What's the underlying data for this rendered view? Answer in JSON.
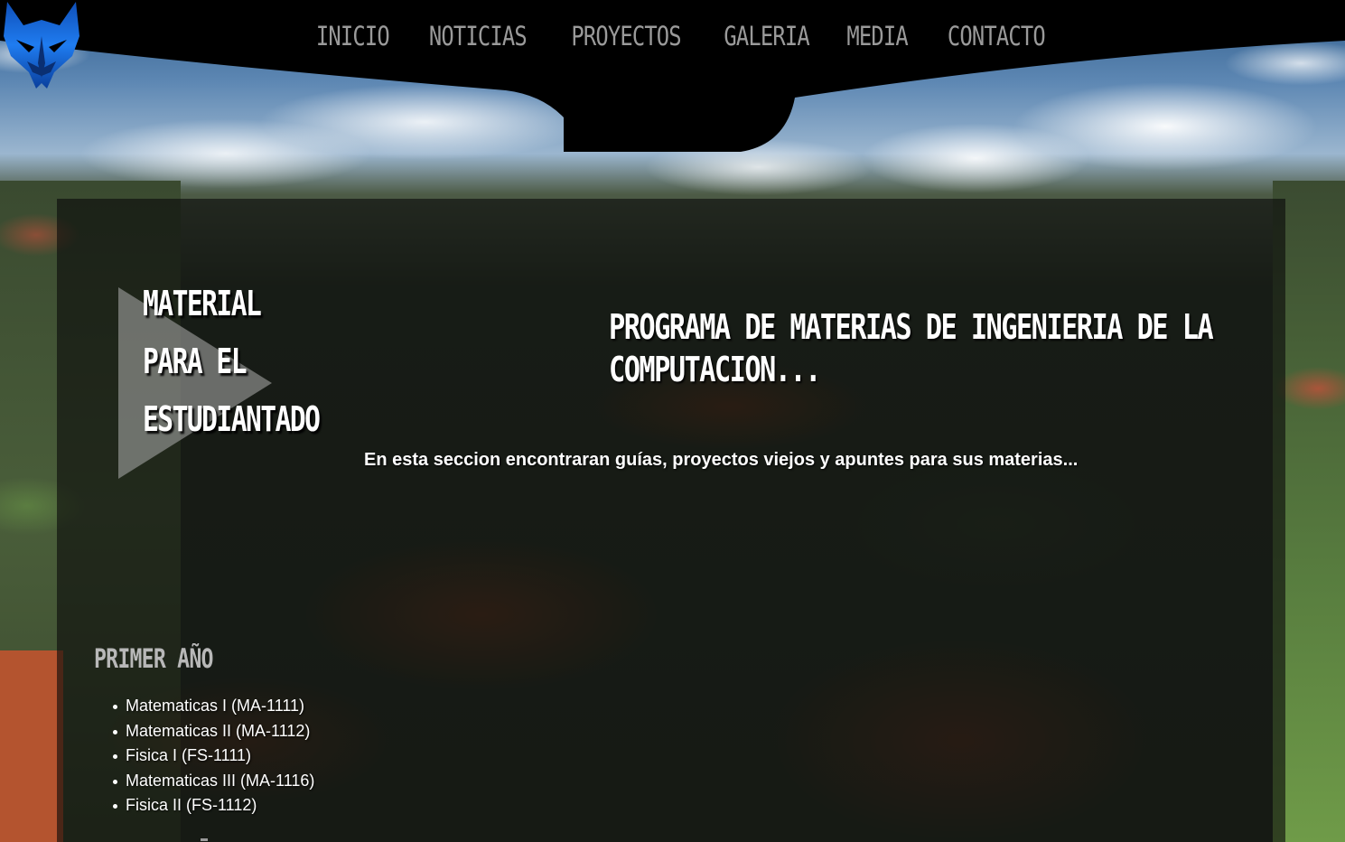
{
  "nav": {
    "items": [
      "INICIO",
      "NOTICIAS",
      "PROYECTOS",
      "GALERIA",
      "MEDIA",
      "CONTACTO"
    ]
  },
  "logo": {
    "icon": "wolf-head-icon",
    "color": "#1a6fe0"
  },
  "hero": {
    "title_lines": [
      "MATERIAL",
      "PARA EL",
      "ESTUDIANTADO"
    ],
    "icon": "play-triangle-icon"
  },
  "program": {
    "title": "PROGRAMA DE MATERIAS DE INGENIERIA DE LA COMPUTACION...",
    "intro": "En esta seccion encontraran guías, proyectos viejos y apuntes para sus materias..."
  },
  "years": [
    {
      "heading": "PRIMER AÑO",
      "courses": [
        "Matematicas I (MA-1111)",
        "Matematicas II (MA-1112)",
        "Fisica I (FS-1111)",
        "Matematicas III (MA-1116)",
        "Fisica II (FS-1112)"
      ]
    }
  ],
  "colors": {
    "nav_background": "#000000",
    "nav_text": "#9a9a9a",
    "accent_blue": "#1a6fe0",
    "heading_text": "#ffffff"
  }
}
